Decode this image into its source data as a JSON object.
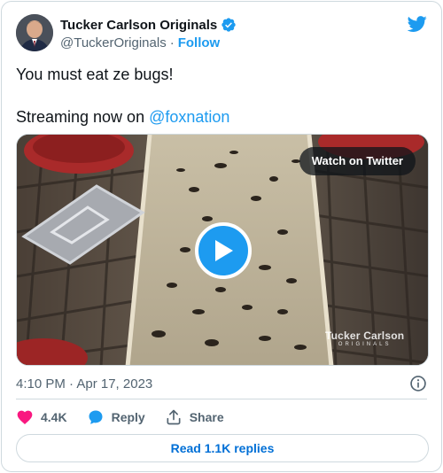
{
  "header": {
    "name": "Tucker Carlson Originals",
    "handle": "@TuckerOriginals",
    "separator": "·",
    "follow_label": "Follow"
  },
  "tweet": {
    "line1": "You must eat ze bugs!",
    "line2_prefix": "Streaming now on ",
    "mention": "@foxnation"
  },
  "media": {
    "watch_label": "Watch on Twitter",
    "watermark_main": "Tucker Carlson",
    "watermark_sub": "ORIGINALS"
  },
  "meta": {
    "timestamp": "4:10 PM · Apr 17, 2023"
  },
  "actions": {
    "like_count": "4.4K",
    "reply_label": "Reply",
    "share_label": "Share"
  },
  "replies_label": "Read 1.1K replies",
  "colors": {
    "accent": "#1d9bf0",
    "like": "#f91880",
    "link": "#006fd6"
  },
  "icons": [
    "verified-badge-icon",
    "twitter-bird-icon",
    "play-icon",
    "info-icon",
    "heart-icon",
    "reply-bubble-icon",
    "share-icon"
  ]
}
